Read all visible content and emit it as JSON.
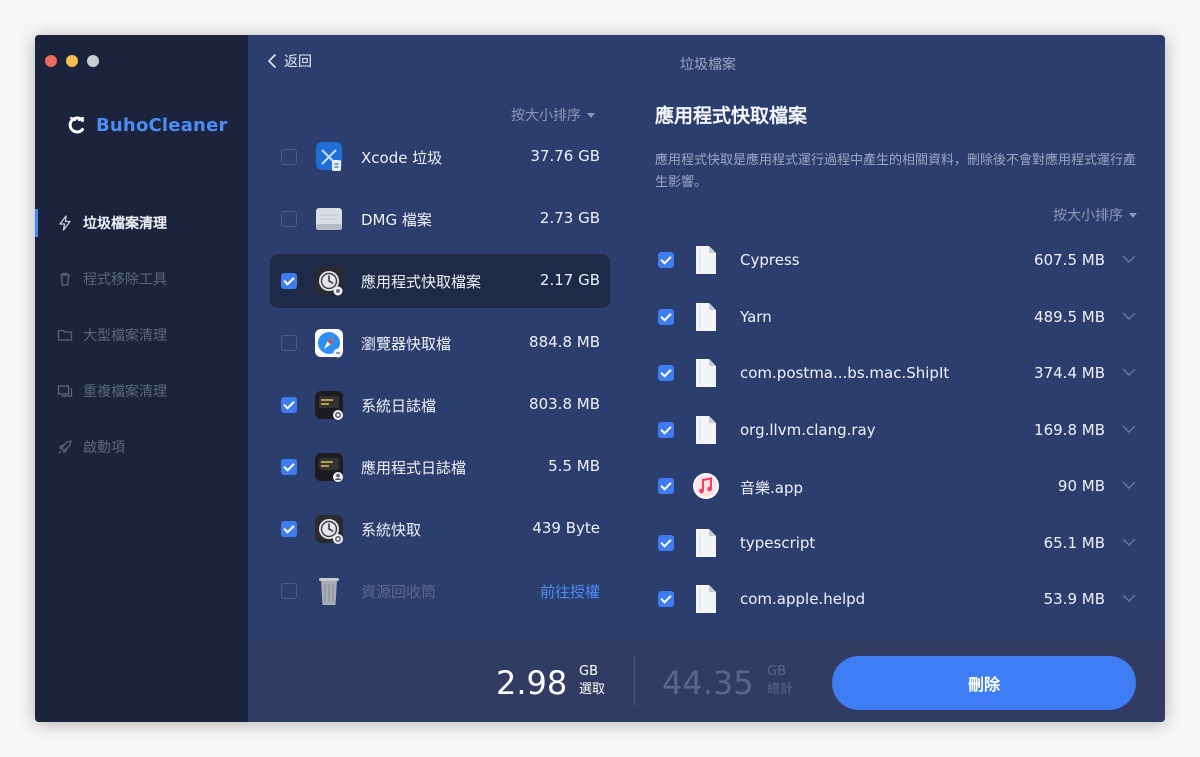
{
  "window": {
    "title": "垃圾檔案"
  },
  "sidebar": {
    "brand": "BuhoCleaner",
    "items": [
      {
        "label": "垃圾檔案清理",
        "icon": "bolt-icon",
        "active": true
      },
      {
        "label": "程式移除工具",
        "icon": "trash-icon",
        "active": false
      },
      {
        "label": "大型檔案清理",
        "icon": "folder-icon",
        "active": false
      },
      {
        "label": "重複檔案清理",
        "icon": "duplicate-icon",
        "active": false
      },
      {
        "label": "啟動項",
        "icon": "rocket-icon",
        "active": false
      }
    ]
  },
  "header": {
    "back_label": "返回"
  },
  "categories": {
    "sort_label": "按大小排序",
    "items": [
      {
        "label": "Xcode 垃圾",
        "size": "37.76 GB",
        "checked": false,
        "icon": "xcode-icon"
      },
      {
        "label": "DMG 檔案",
        "size": "2.73 GB",
        "checked": false,
        "icon": "disk-image-icon"
      },
      {
        "label": "應用程式快取檔案",
        "size": "2.17 GB",
        "checked": true,
        "icon": "app-cache-icon",
        "selected": true
      },
      {
        "label": "瀏覽器快取檔",
        "size": "884.8 MB",
        "checked": false,
        "icon": "safari-icon"
      },
      {
        "label": "系統日誌檔",
        "size": "803.8 MB",
        "checked": true,
        "icon": "system-log-icon"
      },
      {
        "label": "應用程式日誌檔",
        "size": "5.5 MB",
        "checked": true,
        "icon": "app-log-icon"
      },
      {
        "label": "系統快取",
        "size": "439 Byte",
        "checked": true,
        "icon": "system-cache-icon"
      },
      {
        "label": "資源回收筒",
        "size": "前往授權",
        "checked": false,
        "icon": "trash-can-icon",
        "dim": true
      }
    ]
  },
  "detail": {
    "title": "應用程式快取檔案",
    "description": "應用程式快取是應用程式運行過程中產生的相關資料，刪除後不會對應用程式運行產生影響。",
    "sort_label": "按大小排序",
    "files": [
      {
        "name": "Cypress",
        "size": "607.5 MB",
        "checked": true,
        "icon": "document-icon"
      },
      {
        "name": "Yarn",
        "size": "489.5 MB",
        "checked": true,
        "icon": "document-icon"
      },
      {
        "name": "com.postma...bs.mac.ShipIt",
        "size": "374.4 MB",
        "checked": true,
        "icon": "document-icon"
      },
      {
        "name": "org.llvm.clang.ray",
        "size": "169.8 MB",
        "checked": true,
        "icon": "document-icon"
      },
      {
        "name": "音樂.app",
        "size": "90 MB",
        "checked": true,
        "icon": "music-app-icon"
      },
      {
        "name": "typescript",
        "size": "65.1 MB",
        "checked": true,
        "icon": "document-icon"
      },
      {
        "name": "com.apple.helpd",
        "size": "53.9 MB",
        "checked": true,
        "icon": "document-icon"
      }
    ]
  },
  "footer": {
    "selected_value": "2.98",
    "selected_unit": "GB",
    "selected_label": "選取",
    "total_value": "44.35",
    "total_unit": "GB",
    "total_label": "總計",
    "delete_label": "刪除"
  },
  "colors": {
    "accent": "#3f7df5",
    "brand": "#4d8cf5",
    "sidebar_bg": "#1b243c",
    "main_bg": "#2c3e6d",
    "footer_bg": "#323c63"
  }
}
